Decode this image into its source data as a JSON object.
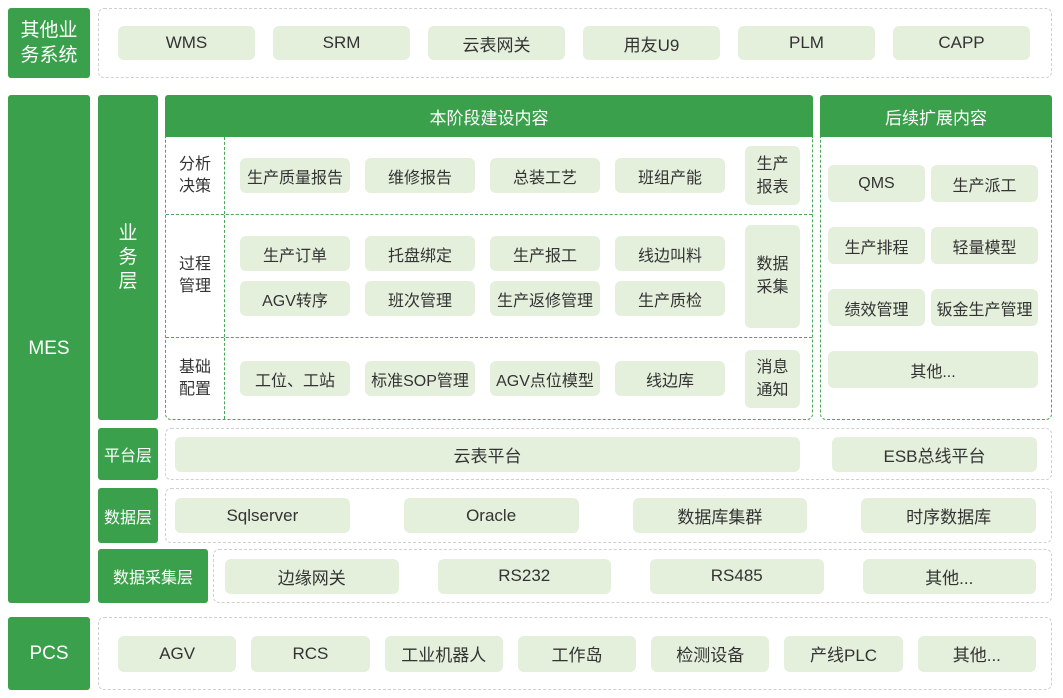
{
  "colors": {
    "primary_green": "#3ba04b",
    "pill_background": "#e4efdc",
    "pill_text": "#333333",
    "label_text": "#ffffff",
    "green_dash": "#4aa65a",
    "gray_dash": "#cfcfcf"
  },
  "other_systems": {
    "label_lines": [
      "其他业",
      "务系统"
    ],
    "items": [
      "WMS",
      "SRM",
      "云表网关",
      "用友U9",
      "PLM",
      "CAPP"
    ]
  },
  "mes": {
    "label": "MES",
    "business_layer": {
      "label_lines": [
        "业",
        "务",
        "层"
      ],
      "current_stage": {
        "header": "本阶段建设内容",
        "sections": [
          {
            "label_lines": [
              "分析",
              "决策"
            ],
            "items": [
              "生产质量报告",
              "维修报告",
              "总装工艺",
              "班组产能"
            ],
            "side_lines": [
              "生产",
              "报表"
            ]
          },
          {
            "label_lines": [
              "过程",
              "管理"
            ],
            "items": [
              "生产订单",
              "托盘绑定",
              "生产报工",
              "线边叫料",
              "AGV转序",
              "班次管理",
              "生产返修管理",
              "生产质检"
            ],
            "side_lines": [
              "数据",
              "采集"
            ]
          },
          {
            "label_lines": [
              "基础",
              "配置"
            ],
            "items": [
              "工位、工站",
              "标准SOP管理",
              "AGV点位模型",
              "线边库"
            ],
            "side_lines": [
              "消息",
              "通知"
            ]
          }
        ]
      },
      "future_extension": {
        "header": "后续扩展内容",
        "items": [
          "QMS",
          "生产派工",
          "生产排程",
          "轻量模型",
          "绩效管理",
          "钣金生产管理"
        ],
        "other": "其他..."
      }
    },
    "platform_layer": {
      "label": "平台层",
      "items": [
        "云表平台",
        "ESB总线平台"
      ]
    },
    "data_layer": {
      "label": "数据层",
      "items": [
        "Sqlserver",
        "Oracle",
        "数据库集群",
        "时序数据库"
      ]
    },
    "data_collection_layer": {
      "label": "数据采集层",
      "items": [
        "边缘网关",
        "RS232",
        "RS485",
        "其他..."
      ]
    }
  },
  "pcs": {
    "label": "PCS",
    "items": [
      "AGV",
      "RCS",
      "工业机器人",
      "工作岛",
      "检测设备",
      "产线PLC",
      "其他..."
    ]
  }
}
